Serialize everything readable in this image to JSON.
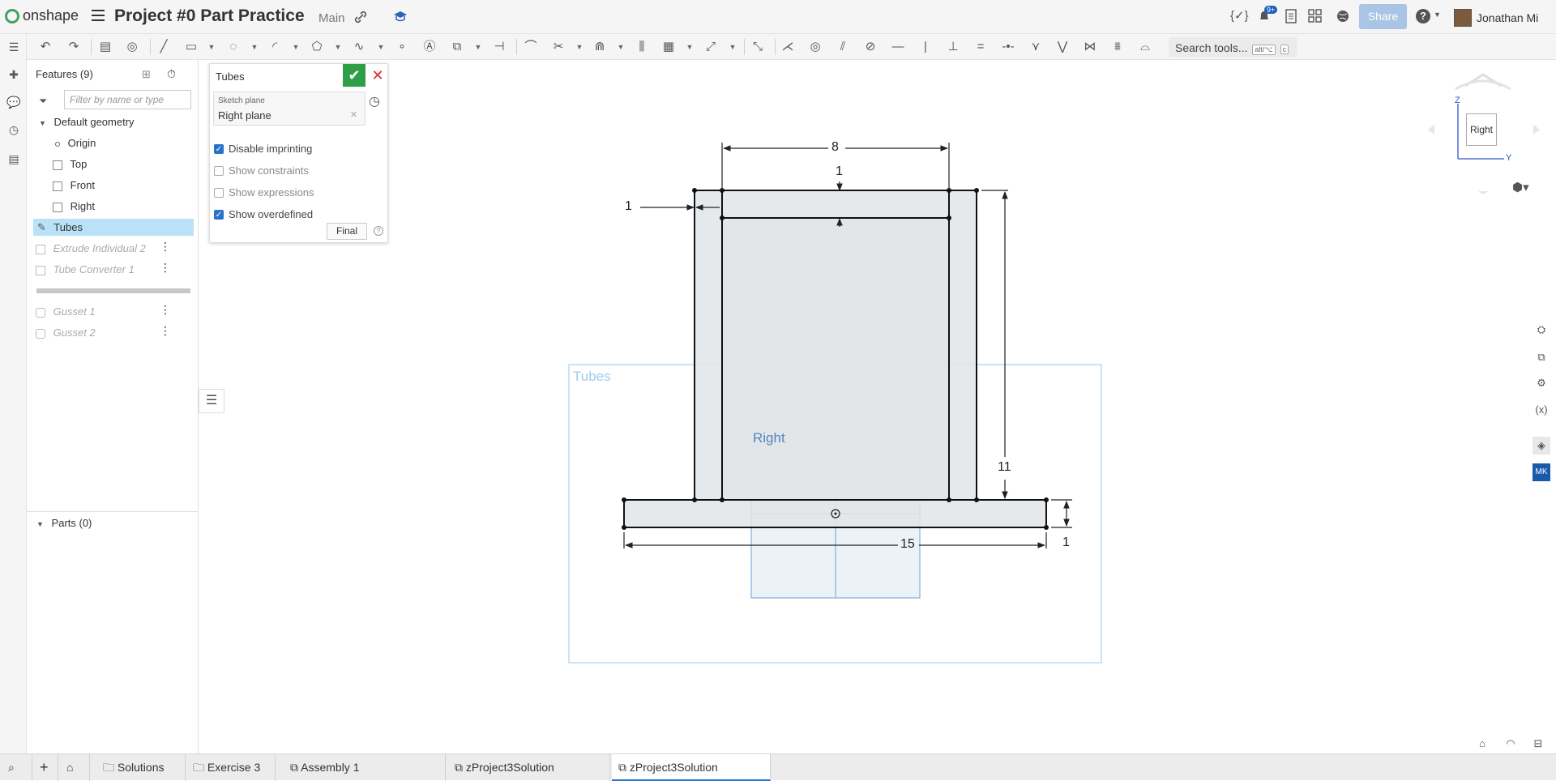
{
  "app": {
    "brand": "onshape",
    "doc_title": "Project #0 Part Practice",
    "workspace": "Main"
  },
  "topbar": {
    "share_label": "Share",
    "notif_badge": "9+",
    "user_name": "Jonathan Mi",
    "help_label": "?"
  },
  "toolbar": {
    "search_label": "Search tools...",
    "search_shortcut_1": "alt/⌥",
    "search_shortcut_2": "c"
  },
  "features": {
    "header": "Features (9)",
    "filter_placeholder": "Filter by name or type",
    "default_geometry": "Default geometry",
    "items": [
      {
        "label": "Origin"
      },
      {
        "label": "Top"
      },
      {
        "label": "Front"
      },
      {
        "label": "Right"
      },
      {
        "label": "Tubes"
      },
      {
        "label": "Extrude Individual 2"
      },
      {
        "label": "Tube Converter 1"
      },
      {
        "label": "Gusset 1"
      },
      {
        "label": "Gusset 2"
      }
    ],
    "parts_header": "Parts (0)"
  },
  "dialog": {
    "title": "Tubes",
    "plane_label": "Sketch plane",
    "plane_value": "Right plane",
    "options": [
      {
        "label": "Disable imprinting",
        "checked": true
      },
      {
        "label": "Show constraints",
        "checked": false
      },
      {
        "label": "Show expressions",
        "checked": false
      },
      {
        "label": "Show overdefined",
        "checked": true
      }
    ],
    "final_label": "Final"
  },
  "canvas": {
    "sketch_label": "Tubes",
    "plane_label": "Right",
    "dimensions": {
      "top_width": "8",
      "top_thickness": "1",
      "left_offset": "1",
      "height": "11",
      "base_width": "15",
      "base_thickness": "1"
    }
  },
  "viewcube": {
    "face": "Right",
    "axis_z": "Z",
    "axis_y": "Y"
  },
  "bottom_tabs": [
    {
      "label": "Solutions"
    },
    {
      "label": "Exercise 3"
    },
    {
      "label": "Assembly 1"
    },
    {
      "label": "zProject3Solution"
    },
    {
      "label": "zProject3Solution"
    }
  ],
  "colors": {
    "accent": "#2673c9",
    "ok": "#2e9e47",
    "cancel": "#d62b2b",
    "selected": "#b9e1f7",
    "sketch_fill": "#e2e5e8",
    "plane": "#9bc7ea"
  }
}
